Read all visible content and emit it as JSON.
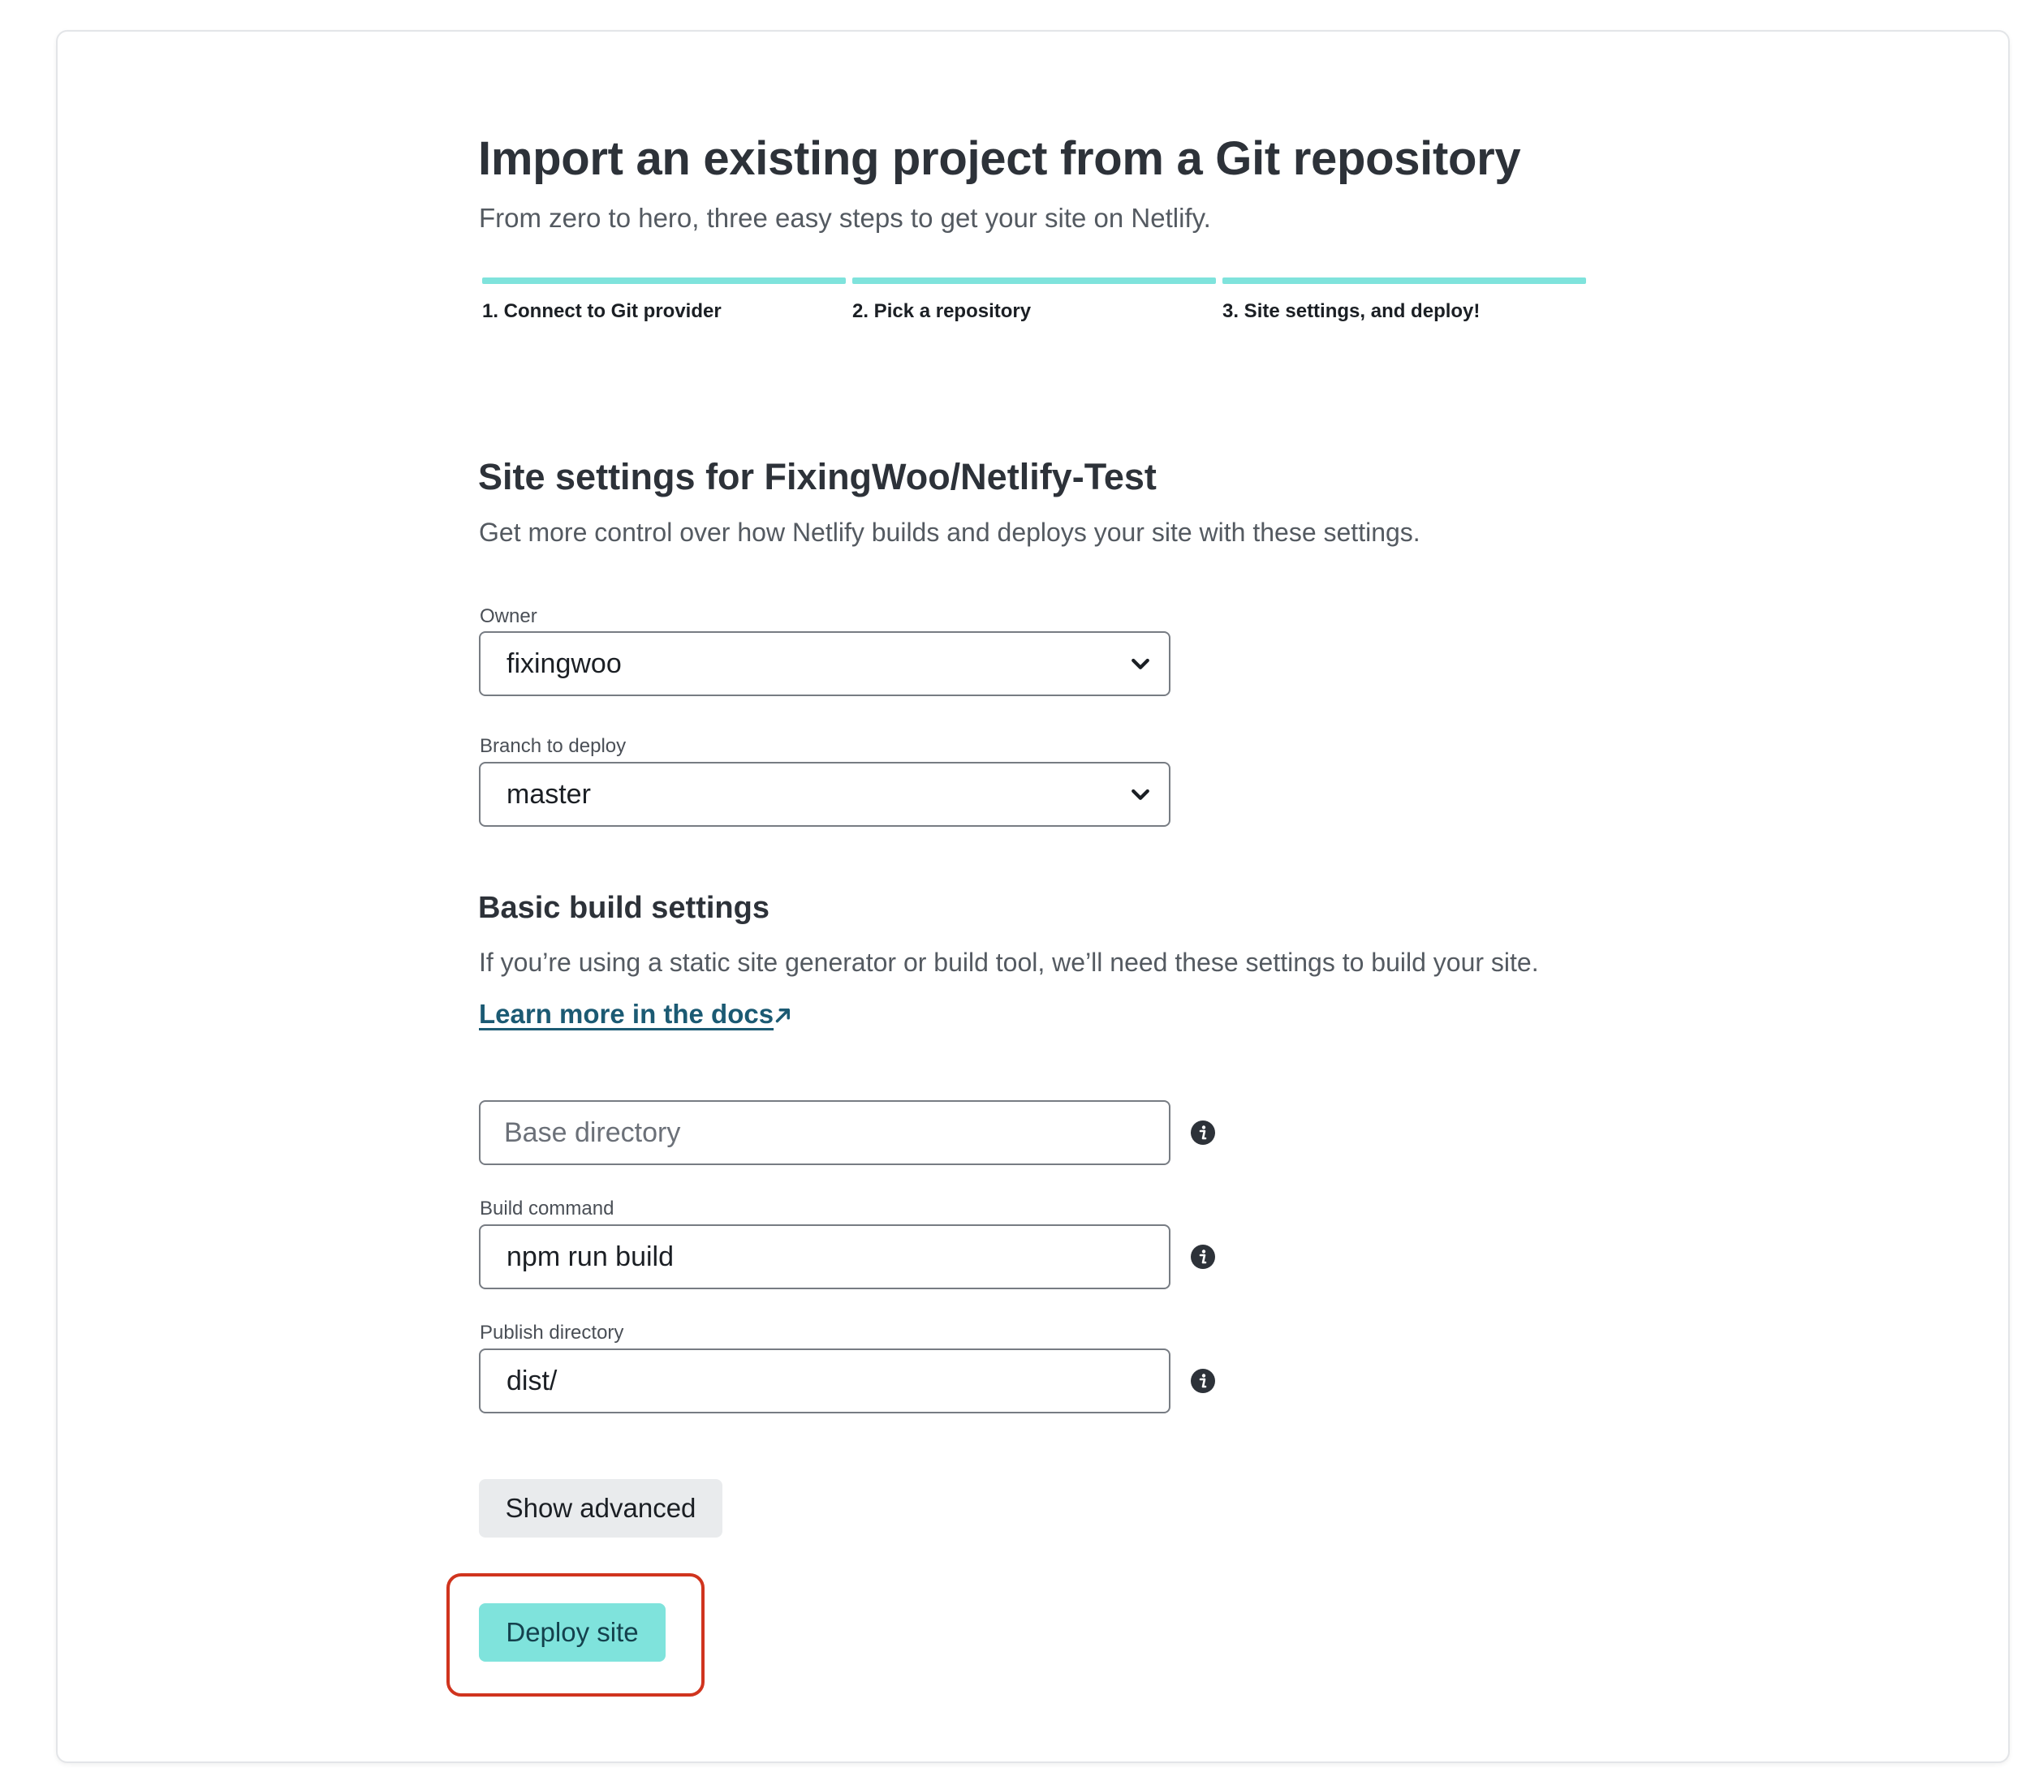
{
  "header": {
    "title": "Import an existing project from a Git repository",
    "subtitle": "From zero to hero, three easy steps to get your site on Netlify."
  },
  "steps": [
    {
      "label": "1. Connect to Git provider"
    },
    {
      "label": "2. Pick a repository"
    },
    {
      "label": "3. Site settings, and deploy!"
    }
  ],
  "site_settings": {
    "heading": "Site settings for FixingWoo/Netlify-Test",
    "description": "Get more control over how Netlify builds and deploys your site with these settings.",
    "owner_label": "Owner",
    "owner_value": "fixingwoo",
    "branch_label": "Branch to deploy",
    "branch_value": "master"
  },
  "build_settings": {
    "heading": "Basic build settings",
    "description": "If you’re using a static site generator or build tool, we’ll need these settings to build your site.",
    "docs_link": "Learn more in the docs",
    "base_dir_placeholder": "Base directory",
    "build_command_label": "Build command",
    "build_command_value": "npm run build",
    "publish_dir_label": "Publish directory",
    "publish_dir_value": "dist/"
  },
  "actions": {
    "show_advanced": "Show advanced",
    "deploy": "Deploy site"
  },
  "colors": {
    "accent": "#7fe3dc",
    "link": "#1b5a73",
    "highlight_outline": "#d0341e"
  },
  "icons": {
    "select_chevron": "chevron-down-icon",
    "external_link": "external-link-icon",
    "info": "info-icon"
  }
}
